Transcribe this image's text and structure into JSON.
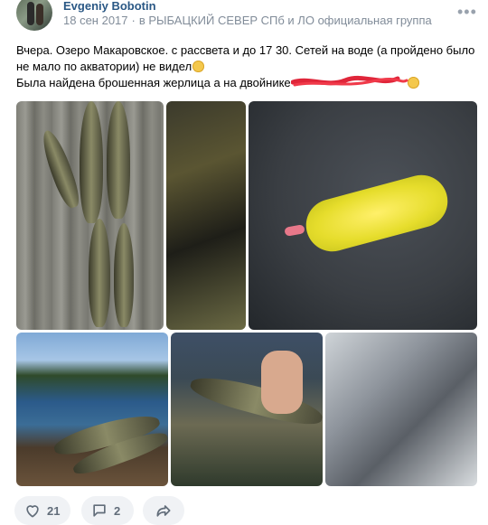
{
  "post": {
    "author": "Evgeniy Bobotin",
    "date": "18 сен 2017",
    "group": "в РЫБАЦКИЙ СЕВЕР СПб и ЛО официальная группа",
    "more_label": "•••",
    "text_line1": "Вчера. Озеро Макаровское. с рассвета и до 17 30. Сетей на воде (а пройдено было не мало по акватории) не видел",
    "text_line2": "Была найдена брошенная жерлица а на двойнике"
  },
  "photos": [
    {
      "alt": "fish-on-planks"
    },
    {
      "alt": "grass-and-shadows"
    },
    {
      "alt": "yellow-caterpillar-on-bag"
    },
    {
      "alt": "lake-and-fish"
    },
    {
      "alt": "pike-in-hand"
    },
    {
      "alt": "reflection-in-water"
    }
  ],
  "actions": {
    "likes": "21",
    "comments": "2"
  },
  "icons": {
    "like": "heart-icon",
    "comment": "comment-icon",
    "share": "share-icon",
    "more": "more-icon"
  },
  "colors": {
    "link": "#2a5885",
    "meta": "#818c99",
    "action_bg": "#f0f2f5",
    "action_text": "#626d7a"
  }
}
